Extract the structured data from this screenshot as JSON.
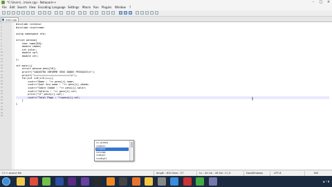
{
  "window": {
    "title": "*C:\\Users\\...\\main.cpp - Notepad++",
    "controls": [
      "–",
      "□",
      "×"
    ]
  },
  "menu": {
    "items": [
      "File",
      "Edit",
      "Search",
      "View",
      "Encoding",
      "Language",
      "Settings",
      "Macro",
      "Run",
      "Plugins",
      "Window",
      "?"
    ]
  },
  "tab": {
    "label": "main.cpp"
  },
  "editor": {
    "line_numbers": [
      "1",
      "2",
      "3",
      "4",
      "5",
      "6",
      "7",
      "8",
      "9",
      "10",
      "11",
      "12",
      "13",
      "14",
      "15",
      "16",
      "17",
      "18",
      "19",
      "20",
      "21",
      "22",
      "23",
      "24",
      "25",
      "26",
      "27",
      "28",
      "29",
      "30"
    ],
    "lines": [
      "#include <cstdio>",
      "#include <iostream>",
      "",
      "using namespace std;",
      "",
      "struct pessoa{",
      "    char nome[50];",
      "    double idade;",
      "    int salar;",
      "    double cpf;",
      "    double cel;",
      "};",
      "",
      "int main(){",
      "    struct pessoa pess[10];",
      "    printf(\"CADASTRO INFORME SEUS DADOS PESSOAIS\\n\");",
      "    printf(\"========================\\n\");",
      "    for(int i=0;i<5;i++){",
      "        cout<<\"Nome : \"<< pess[i].nome;",
      "        cout<<\"Qual Seu nome : \"<< pess[i].idade;",
      "        cout<<\"Sobre Idade : \"<< pess[i].salar;",
      "        cout<<\"Salario : \"<< pess[i].cel;",
      "        print(\"%f\",pess[i].cpf);",
      "        cout<<\"Total Pago : \"<<pess[i].cel;",
      "    }",
      "}",
      "",
      "",
      "",
      ""
    ],
    "current_line": 23
  },
  "autocomplete": {
    "items": [
      "is_wiskey",
      "ispanic",
      "isspace",
      "istream",
      "isdigit",
      "isxdigit"
    ],
    "selected_index": 2
  },
  "statusbar": {
    "file_type": "C++ source file",
    "length": "length : 620    lines : 27",
    "position": "Ln : 24    Col : 26    Sel : 0 | 0",
    "eol": "Dos\\Windows",
    "encoding": "UTF-8",
    "mode": "INS"
  },
  "taskbar": {
    "apps": [
      "explorer",
      "chrome",
      "notepad",
      "photoshop",
      "premiere",
      "aftereffects",
      "media",
      "vlc",
      "obs",
      "firefox",
      "folder",
      "settings",
      "app",
      "app2",
      "app3",
      "app4"
    ],
    "tray": "▲ ♪ ▮"
  },
  "colors": {
    "accent": "#3476d6",
    "taskbar": "#1b2a3f"
  }
}
